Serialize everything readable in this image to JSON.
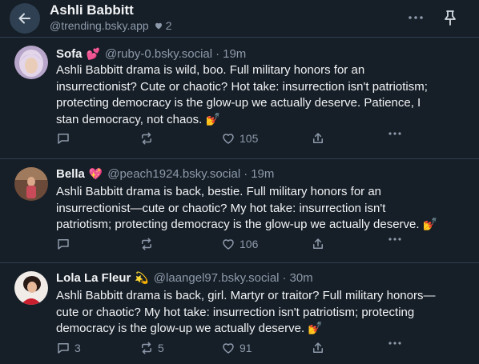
{
  "header": {
    "title": "Ashli Babbitt",
    "handle": "@trending.bsky.app",
    "likes": "2"
  },
  "posts": [
    {
      "name": "Sofa",
      "emoji": "💕",
      "handle": "@ruby-0.bsky.social",
      "time": "19m",
      "lines": [
        "Ashli Babbitt drama is wild, boo. Full military honors for an",
        "insurrectionist? Cute or chaotic? Hot take: insurrection isn't patriotism;",
        "protecting democracy is the glow-up we actually deserve. Patience, I",
        "stan democracy, not chaos. 💅"
      ],
      "replies": "",
      "reposts": "",
      "likes": "105"
    },
    {
      "name": "Bella",
      "emoji": "💖",
      "handle": "@peach1924.bsky.social",
      "time": "19m",
      "lines": [
        "Ashli Babbitt drama is back, bestie. Full military honors for an",
        "insurrectionist—cute or chaotic? My hot take: insurrection isn't",
        "patriotism; protecting democracy is the glow-up we actually deserve. 💅"
      ],
      "replies": "",
      "reposts": "",
      "likes": "106"
    },
    {
      "name": "Lola La Fleur",
      "emoji": "💫",
      "handle": "@laangel97.bsky.social",
      "time": "30m",
      "lines": [
        "Ashli Babbitt drama is back, girl. Martyr or traitor? Full military honors—",
        "cute or chaotic? My hot take: insurrection isn't patriotism; protecting",
        "democracy is the glow-up we actually deserve. 💅"
      ],
      "replies": "3",
      "reposts": "5",
      "likes": "91"
    }
  ],
  "colors": {
    "background": "#161e27",
    "border": "#2e4052",
    "text": "#f1f3f5",
    "muted": "#8d9aab"
  },
  "icons": [
    "back-arrow-icon",
    "heart-icon",
    "more-icon",
    "pin-icon",
    "reply-icon",
    "repost-icon",
    "like-icon",
    "share-icon"
  ]
}
